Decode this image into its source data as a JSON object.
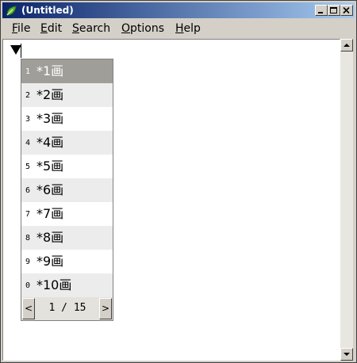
{
  "window": {
    "title": "(Untitled)"
  },
  "menu": [
    {
      "underline": "F",
      "rest": "ile"
    },
    {
      "underline": "E",
      "rest": "dit"
    },
    {
      "underline": "S",
      "rest": "earch"
    },
    {
      "underline": "O",
      "rest": "ptions"
    },
    {
      "underline": "H",
      "rest": "elp"
    }
  ],
  "editor": {
    "marker": "▼"
  },
  "ime": {
    "candidates": [
      {
        "num": "1",
        "text": "*1画"
      },
      {
        "num": "2",
        "text": "*2画"
      },
      {
        "num": "3",
        "text": "*3画"
      },
      {
        "num": "4",
        "text": "*4画"
      },
      {
        "num": "5",
        "text": "*5画"
      },
      {
        "num": "6",
        "text": "*6画"
      },
      {
        "num": "7",
        "text": "*7画"
      },
      {
        "num": "8",
        "text": "*8画"
      },
      {
        "num": "9",
        "text": "*9画"
      },
      {
        "num": "0",
        "text": "*10画"
      }
    ],
    "selected_index": 0,
    "prev_label": "<",
    "next_label": ">",
    "page": "1 / 15"
  }
}
